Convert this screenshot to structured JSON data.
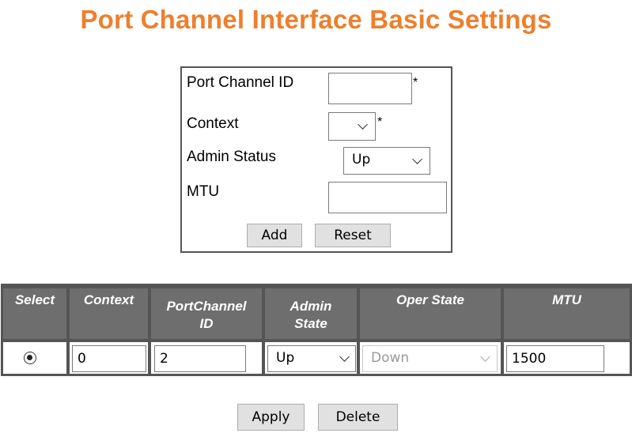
{
  "page": {
    "title": "Port Channel Interface Basic Settings"
  },
  "form": {
    "port_channel_id_label": "Port Channel ID",
    "port_channel_id_value": "",
    "context_label": "Context",
    "context_value": "",
    "admin_status_label": "Admin Status",
    "admin_status_value": "Up",
    "mtu_label": "MTU",
    "mtu_value": "",
    "required_mark": "*",
    "add_label": "Add",
    "reset_label": "Reset"
  },
  "table": {
    "headers": {
      "select": "Select",
      "context": "Context",
      "portchannel_id_line1": "PortChannel",
      "portchannel_id_line2": "ID",
      "admin_state_line1": "Admin",
      "admin_state_line2": "State",
      "oper_state": "Oper State",
      "mtu": "MTU"
    },
    "rows": [
      {
        "selected": true,
        "context": "0",
        "portchannel_id": "2",
        "admin_state": "Up",
        "oper_state": "Down",
        "mtu": "1500"
      }
    ]
  },
  "actions": {
    "apply_label": "Apply",
    "delete_label": "Delete"
  },
  "colors": {
    "title": "#ee7f2d",
    "table_header_bg": "#6e6e6e",
    "table_border": "#555555",
    "button_bg": "#e1e1e1"
  }
}
